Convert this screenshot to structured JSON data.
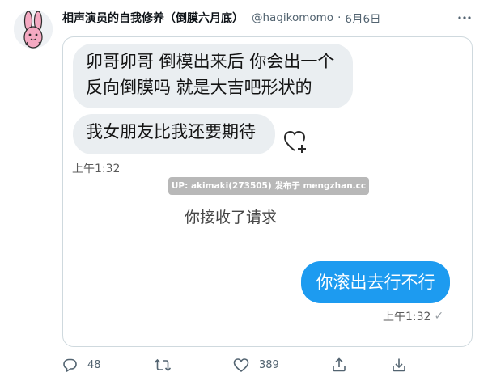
{
  "tweet": {
    "author_name": "相声演员的自我修养（倒膜六月底）",
    "handle": "@hagikomomo",
    "separator": "·",
    "date": "6月6日"
  },
  "media": {
    "messages": [
      {
        "side": "left",
        "text_line1": "卯哥卯哥 倒模出来后 你会出一个",
        "text_line2": "反向倒膜吗 就是大吉吧形状的"
      },
      {
        "side": "left",
        "text": "我女朋友比我还要期待"
      }
    ],
    "left_timestamp": "上午1:32",
    "watermark": "UP: akimaki(273505) 发布于 mengzhan.cc",
    "system_message": "你接收了请求",
    "reply": {
      "side": "right",
      "text": "你滚出去行不行"
    },
    "right_timestamp": "上午1:32",
    "read_mark": "✓"
  },
  "actions": {
    "reply_count": "48",
    "like_count": "389"
  },
  "colors": {
    "accent": "#1d9bf0",
    "bubble_gray": "#eaeef1",
    "secondary_text": "#536471"
  },
  "icons": [
    "rabbit-avatar",
    "more-icon",
    "heart-plus-icon",
    "reply-icon",
    "retweet-icon",
    "like-icon",
    "share-icon",
    "download-icon"
  ]
}
